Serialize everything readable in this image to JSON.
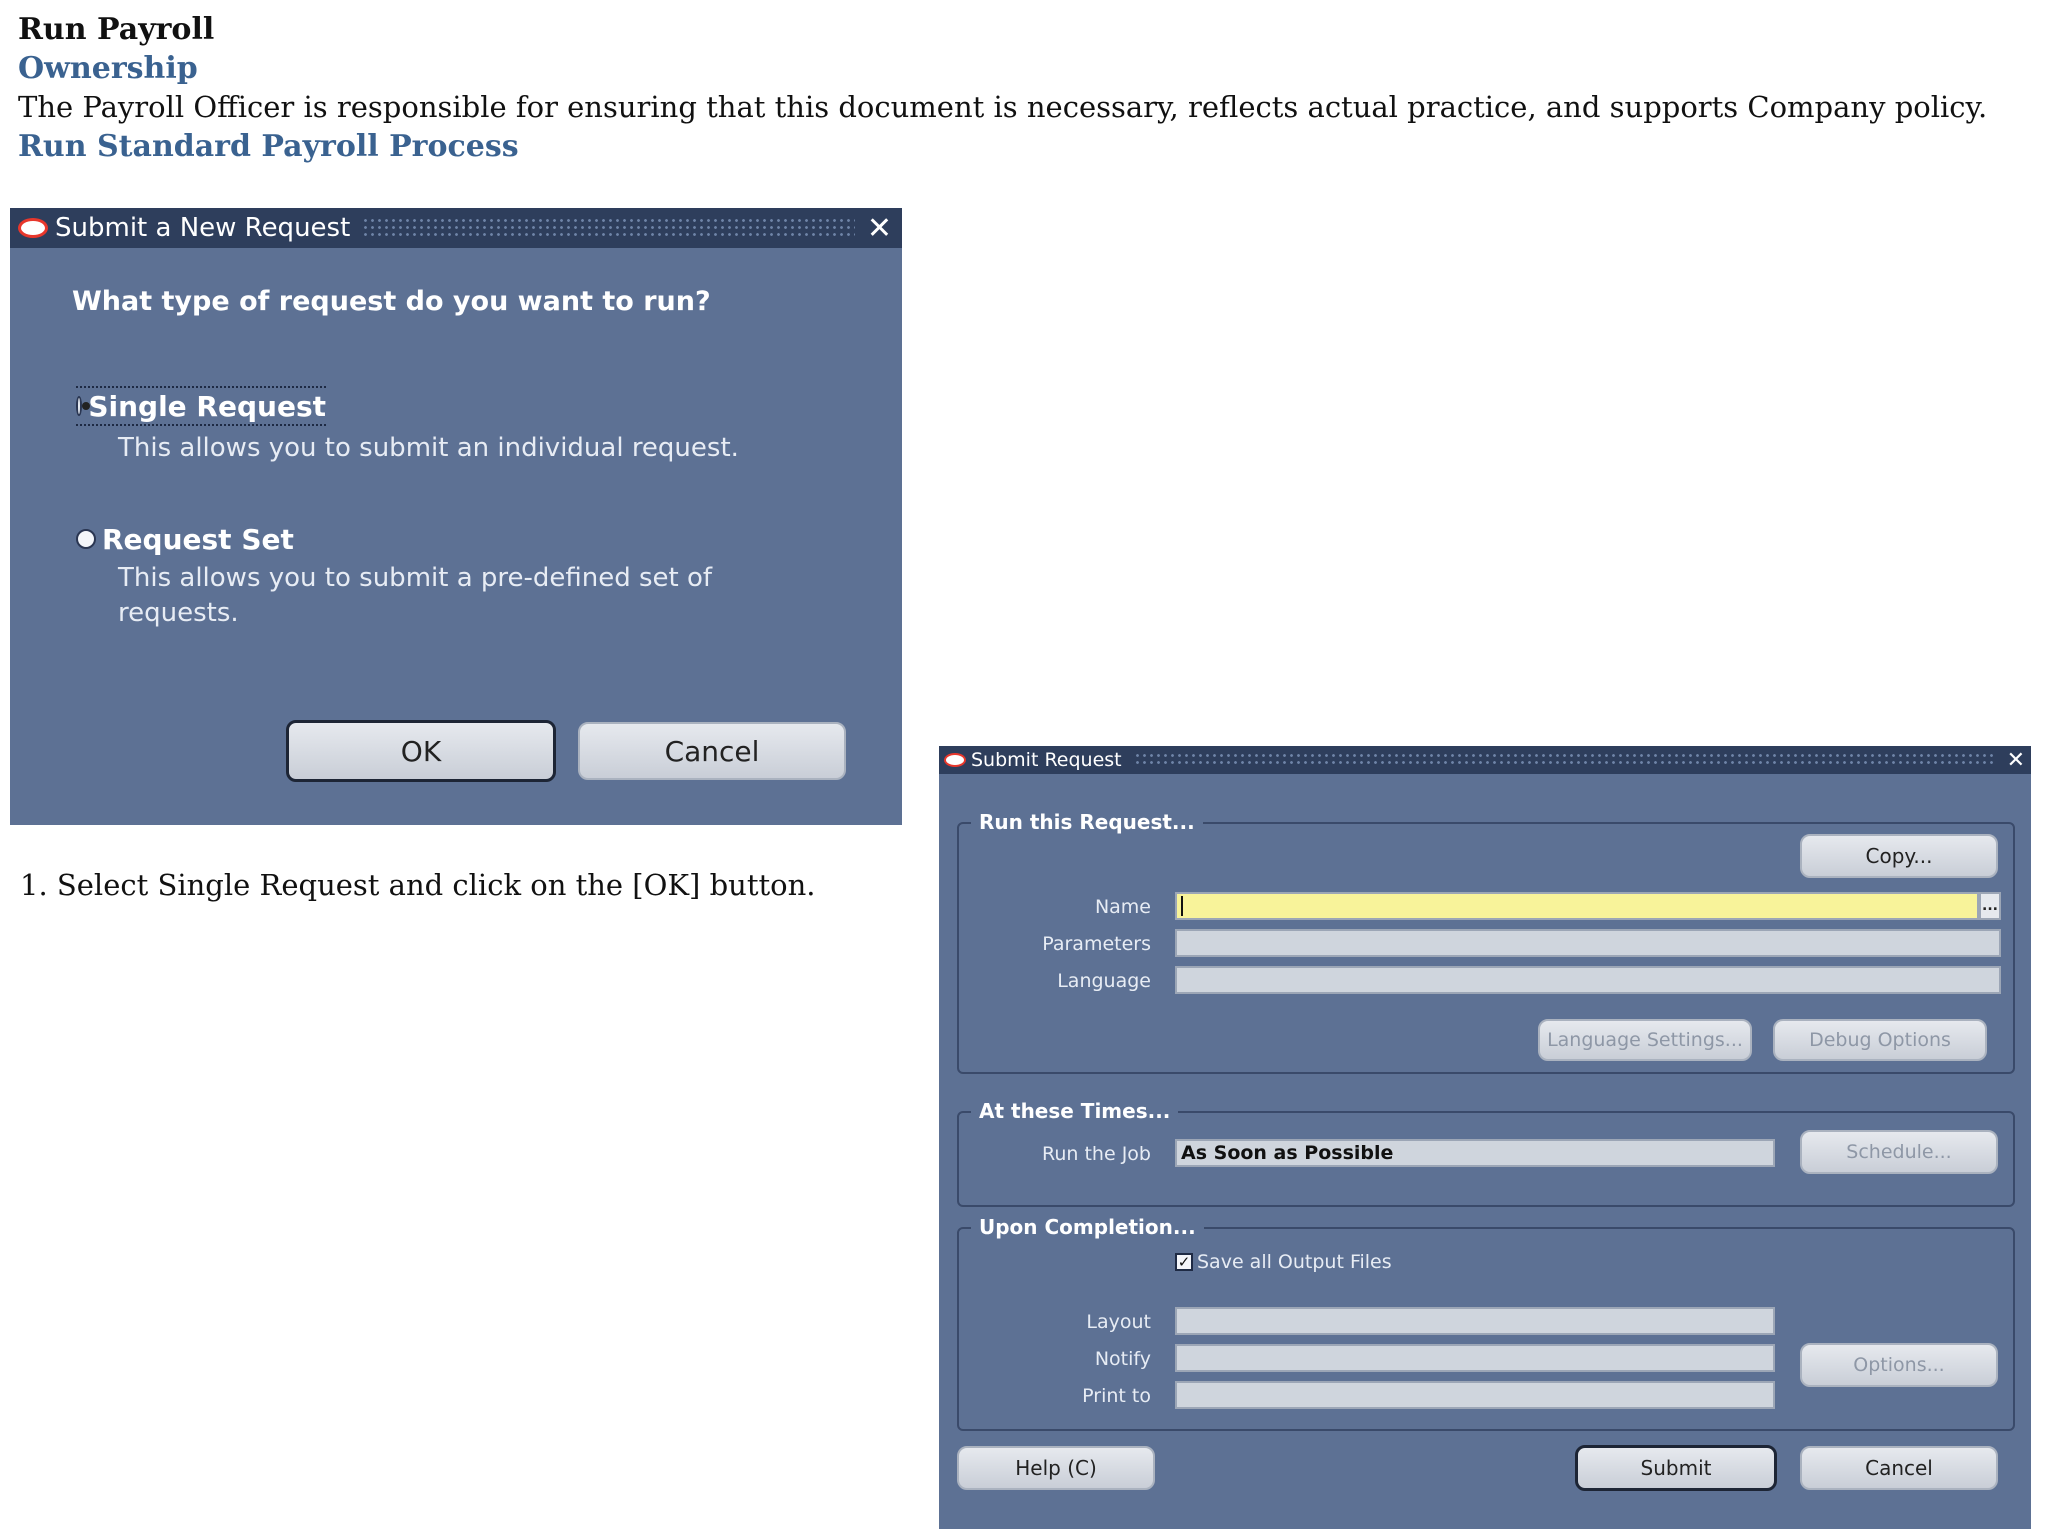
{
  "document": {
    "title": "Run Payroll",
    "ownership_heading": "Ownership",
    "ownership_text": "The Payroll Officer is responsible for ensuring that this document is necessary, reflects actual practice, and supports Company policy.",
    "process_heading": "Run Standard Payroll Process",
    "step_1": "1. Select Single Request and click on the [OK] button."
  },
  "dialog1": {
    "title": "Submit a New Request",
    "question": "What type of request do you want to run?",
    "option_single": {
      "label": "Single Request",
      "description": "This allows you to submit an individual request.",
      "selected": true
    },
    "option_set": {
      "label": "Request Set",
      "description_line1": "This allows you to submit a pre-defined set of",
      "description_line2": "requests.",
      "selected": false
    },
    "ok_label": "OK",
    "cancel_label": "Cancel"
  },
  "dialog2": {
    "title": "Submit Request",
    "run_group": {
      "label": "Run this Request...",
      "copy_label": "Copy...",
      "name_label": "Name",
      "name_value": "",
      "parameters_label": "Parameters",
      "parameters_value": "",
      "language_label": "Language",
      "language_value": "",
      "lov_label": "...",
      "language_settings_label": "Language Settings...",
      "debug_options_label": "Debug Options"
    },
    "times_group": {
      "label": "At these Times...",
      "run_job_label": "Run the Job",
      "run_job_value": "As Soon as Possible",
      "schedule_label": "Schedule..."
    },
    "completion_group": {
      "label": "Upon Completion...",
      "save_output_label": "Save all Output Files",
      "save_output_checked": true,
      "layout_label": "Layout",
      "layout_value": "",
      "notify_label": "Notify",
      "notify_value": "",
      "print_to_label": "Print to",
      "print_to_value": "",
      "options_label": "Options..."
    },
    "help_label": "Help (C)",
    "submit_label": "Submit",
    "cancel_label": "Cancel"
  },
  "colors": {
    "window_body": "#5d7194",
    "titlebar": "#2e3e5c",
    "heading_blue": "#3a6290",
    "required_field": "#f8f39a",
    "oracle_red": "#e8372c"
  }
}
